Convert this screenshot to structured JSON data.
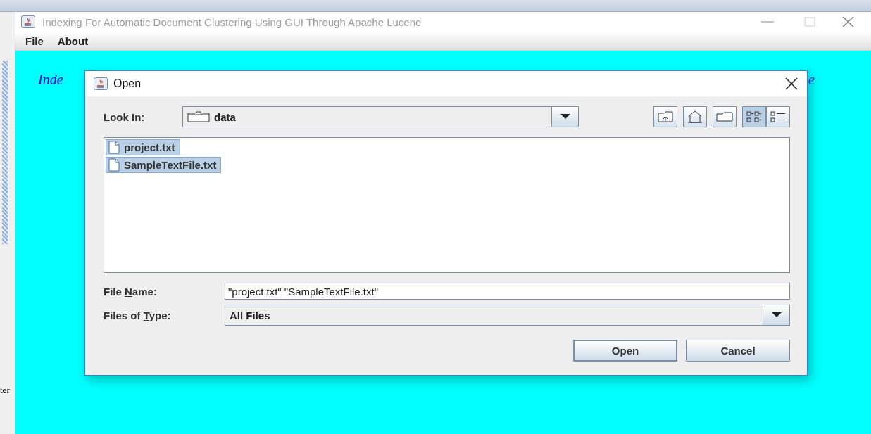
{
  "side_strip": {
    "text": "ter"
  },
  "window": {
    "title": "Indexing For Automatic Document Clustering Using GUI Through Apache Lucene"
  },
  "menu": [
    "File",
    "About"
  ],
  "content": {
    "heading_fragments": [
      "Inde",
      "e"
    ]
  },
  "dialog": {
    "title": "Open",
    "look_in": {
      "label": {
        "before": "Look ",
        "key": "I",
        "after": "n:"
      },
      "value": "data"
    },
    "view_buttons": [
      {
        "kind": "list",
        "selected": true
      },
      {
        "kind": "details",
        "selected": false
      }
    ],
    "files": [
      {
        "name": "project.txt",
        "selected": true
      },
      {
        "name": "SampleTextFile.txt",
        "selected": true
      }
    ],
    "file_name": {
      "label": {
        "before": "File ",
        "key": "N",
        "after": "ame:"
      },
      "value": "\"project.txt\" \"SampleTextFile.txt\""
    },
    "file_type": {
      "label": {
        "before": "Files of ",
        "key": "T",
        "after": "ype:"
      },
      "value": "All Files"
    },
    "buttons": [
      "Open",
      "Cancel"
    ]
  }
}
